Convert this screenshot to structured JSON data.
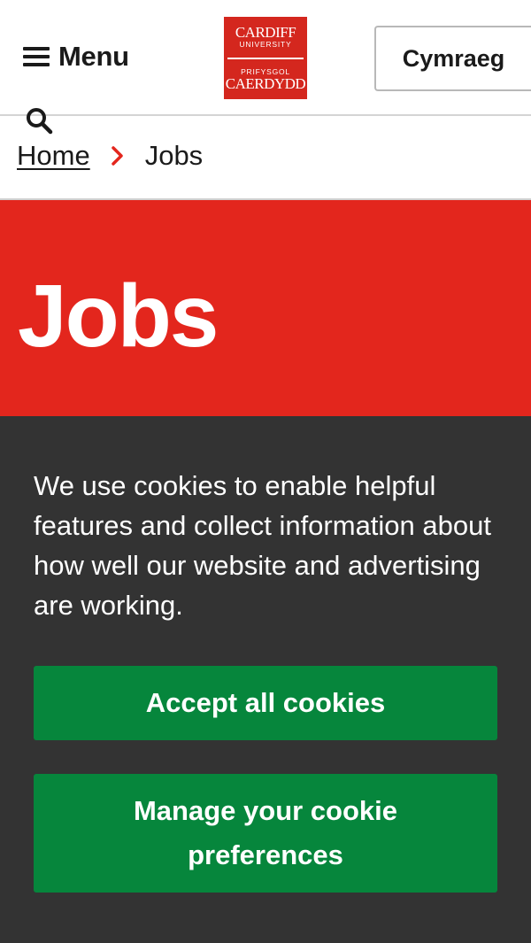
{
  "header": {
    "menu_label": "Menu",
    "language_button": "Cymraeg",
    "logo": {
      "line1": "CARDIFF",
      "line2": "UNIVERSITY",
      "line3": "PRIFYSGOL",
      "line4": "CAERDYDD"
    }
  },
  "breadcrumb": {
    "home": "Home",
    "current": "Jobs"
  },
  "hero": {
    "title": "Jobs"
  },
  "cookie_banner": {
    "message": "We use cookies to enable helpful features and collect information about how well our website and advertising are working.",
    "accept_label": "Accept all cookies",
    "manage_label": "Manage your cookie preferences"
  },
  "colors": {
    "brand_red": "#e3261d",
    "cookie_bg": "#333333",
    "button_green": "#06863c"
  }
}
